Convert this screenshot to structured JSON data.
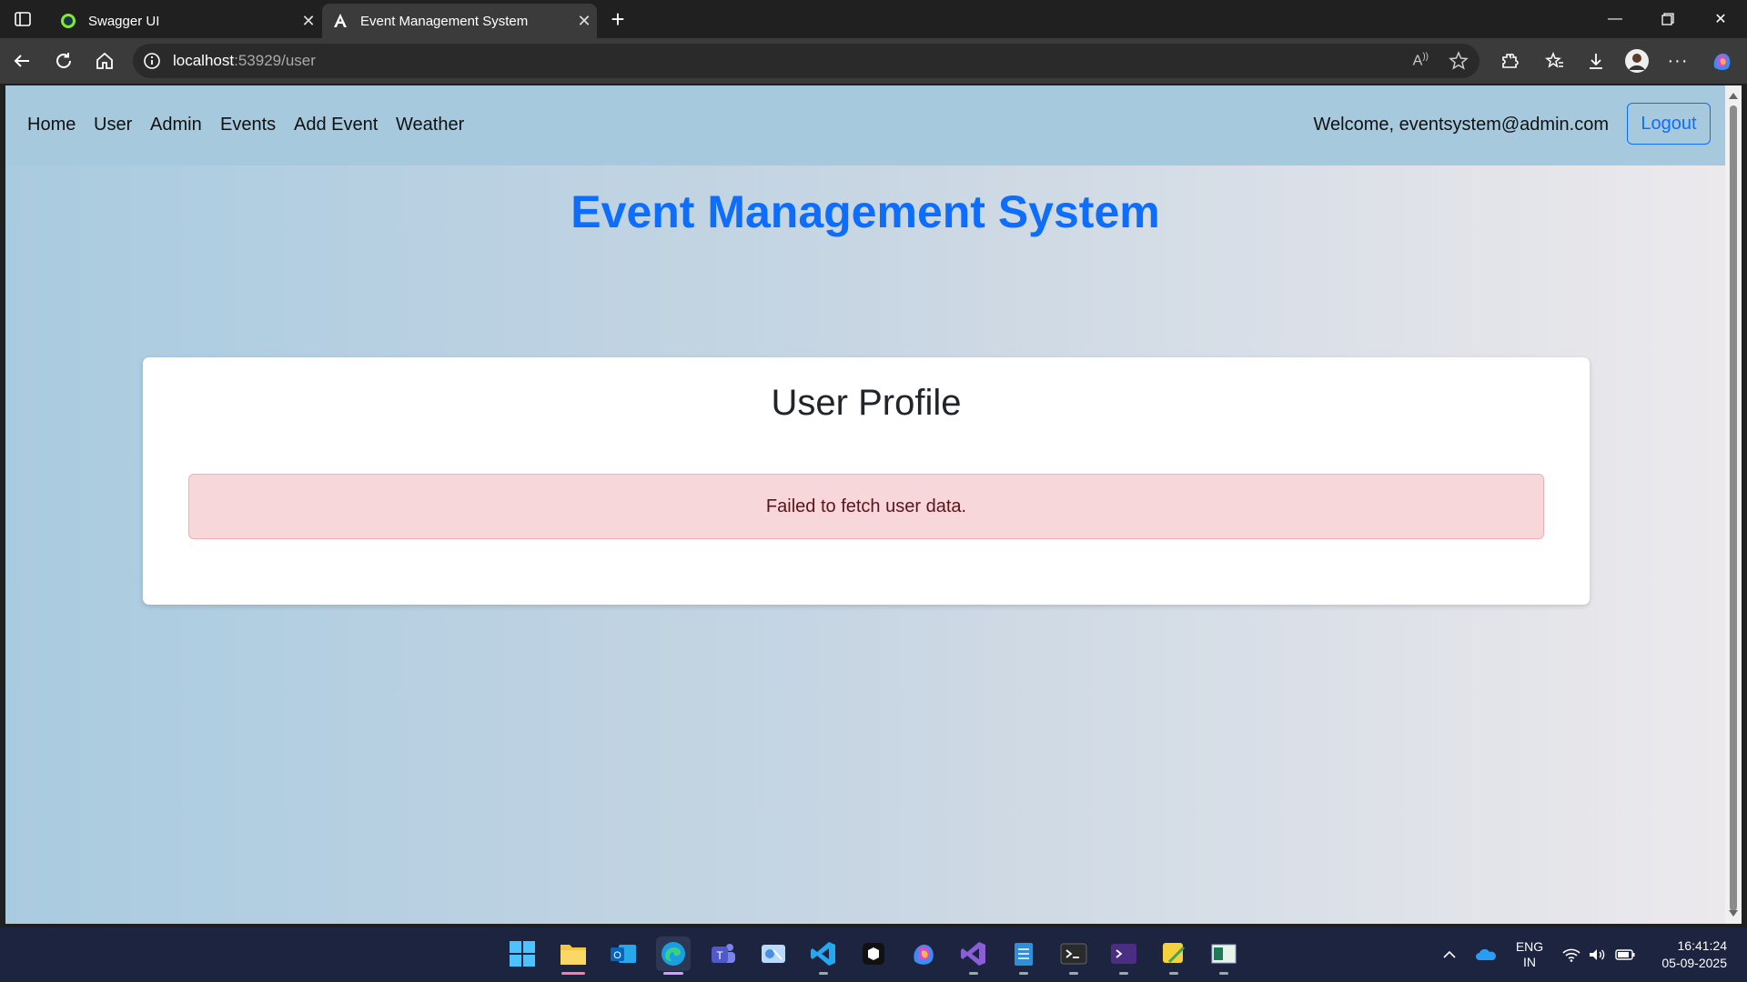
{
  "browser": {
    "tabs": [
      {
        "title": "Swagger UI",
        "favicon": "swagger-icon"
      },
      {
        "title": "Event Management System",
        "favicon": "angular-icon"
      }
    ],
    "url": {
      "host": "localhost",
      "path": ":53929/user"
    }
  },
  "nav": {
    "links": [
      "Home",
      "User",
      "Admin",
      "Events",
      "Add Event",
      "Weather"
    ],
    "welcome": "Welcome, eventsystem@admin.com",
    "logout": "Logout"
  },
  "page": {
    "app_title": "Event Management System",
    "card_title": "User Profile",
    "error": "Failed to fetch user data."
  },
  "taskbar": {
    "lang": "ENG",
    "region": "IN",
    "time": "16:41:24",
    "date": "05-09-2025"
  },
  "colors": {
    "accent": "#0d6efd",
    "alert_bg": "#f8d7da",
    "nav_bg": "#a7c9dd"
  }
}
